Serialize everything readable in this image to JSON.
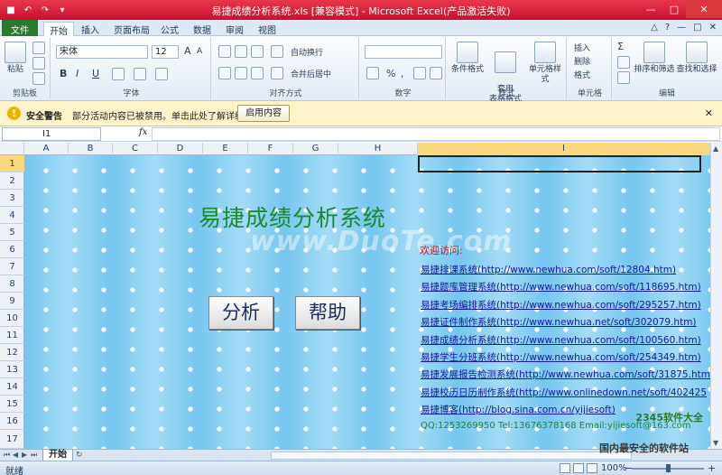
{
  "window": {
    "title": "易捷成绩分析系统.xls  [兼容模式]  -  Microsoft Excel(产品激活失败)",
    "qat": [
      "■",
      "↶",
      "↷",
      "▾"
    ],
    "controls": [
      "—",
      "□",
      "✕"
    ]
  },
  "tabs": {
    "file": "文件",
    "items": [
      "开始",
      "插入",
      "页面布局",
      "公式",
      "数据",
      "审阅",
      "视图"
    ],
    "active": "开始",
    "right": [
      "△",
      "?",
      "—",
      "□",
      "✕"
    ]
  },
  "ribbon": {
    "clipboard": {
      "paste": "粘贴",
      "label": "剪贴板"
    },
    "font": {
      "name": "宋体",
      "size": "12",
      "label": "字体",
      "buttons": [
        "B",
        "I",
        "U",
        "A",
        "A"
      ]
    },
    "alignment": {
      "wrap": "自动换行",
      "merge": "合并后居中",
      "label": "对齐方式"
    },
    "number": {
      "buttons": [
        "%",
        ","
      ],
      "label": "数字"
    },
    "styles": {
      "conditional": "条件格式",
      "table": "套用\n表格格式",
      "cell": "单元格样式",
      "label": "样式"
    },
    "cells": {
      "insert": "插入",
      "delete": "删除",
      "format": "格式",
      "label": "单元格"
    },
    "editing": {
      "sum": "Σ",
      "sort": "排序和筛选",
      "find": "查找和选择",
      "label": "编辑"
    }
  },
  "security": {
    "icon": "!",
    "title": "安全警告",
    "message": "部分活动内容已被禁用。单击此处了解详细信息。",
    "enable": "启用内容",
    "close": "✕"
  },
  "formula": {
    "namebox": "I1",
    "fx": "fx",
    "value": ""
  },
  "grid": {
    "columns": [
      "A",
      "B",
      "C",
      "D",
      "E",
      "F",
      "G",
      "H",
      "I"
    ],
    "selected_column": "I",
    "rows": [
      "1",
      "2",
      "3",
      "4",
      "5",
      "6",
      "7",
      "8",
      "9",
      "10",
      "11",
      "12",
      "13",
      "14",
      "15",
      "16",
      "17"
    ],
    "selected_row": "1"
  },
  "sheet": {
    "watermark": "www.DuoTe.com",
    "title": "易捷成绩分析系统",
    "analyze": "分析",
    "help": "帮助",
    "welcome": "欢迎访问:",
    "links": [
      "易捷排课系统(http://www.newhua.com/soft/12804.htm)",
      "易捷题库管理系统(http://www.newhua.com/soft/118695.htm)",
      "易捷考场编排系统(http://www.newhua.com/soft/295257.htm)",
      "易捷证件制作系统(http://www.newhua.net/soft/302079.htm)",
      "易捷成绩分析系统(http://www.newhua.com/soft/100560.htm)",
      "易捷学生分班系统(http://www.newhua.com/soft/254349.htm)",
      "易捷发展报告检测系统(http://www.newhua.com/soft/31875.htm)",
      "易捷校历日历制作系统(http://www.onlinedown.net/soft/402425",
      "易捷博客(http://blog.sina.com.cn/yijiesoft)"
    ],
    "contact": "QQ:1253269950   Tel:13676378168   Email:yijiesoft@163.com",
    "corner_logo": "2345软件大全"
  },
  "sheettabs": {
    "nav": [
      "⏮",
      "◀",
      "▶",
      "⏭"
    ],
    "active": "开始",
    "new": "↻"
  },
  "status": {
    "ready": "就绪",
    "zoom": "100%",
    "minus": "−",
    "plus": "+",
    "footer_wm": "国内最安全的软件站"
  }
}
